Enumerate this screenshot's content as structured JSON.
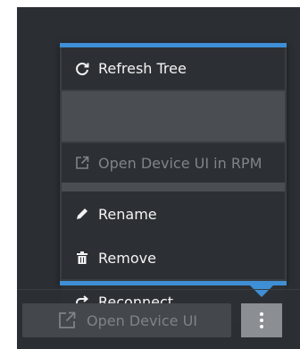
{
  "menu": {
    "items": [
      {
        "label": "Refresh Tree",
        "icon": "refresh-icon",
        "enabled": true
      },
      {
        "label": "Open Device UI in RPM",
        "icon": "external-link-icon",
        "enabled": false
      },
      {
        "label": "Rename",
        "icon": "pencil-icon",
        "enabled": true
      },
      {
        "label": "Remove",
        "icon": "trash-icon",
        "enabled": true
      },
      {
        "label": "Reconnect",
        "icon": "redo-arrow-icon",
        "enabled": true
      }
    ]
  },
  "footer": {
    "open_device_label": "Open Device UI",
    "open_device_icon": "external-link-icon",
    "more_icon": "kebab-menu-icon"
  },
  "colors": {
    "accent": "#3f8fd6",
    "panel": "#2b2f33",
    "menu_item": "#2c3034",
    "text": "#f3f3f3",
    "disabled_text": "#808488",
    "kebab_button": "#8b8f93"
  }
}
